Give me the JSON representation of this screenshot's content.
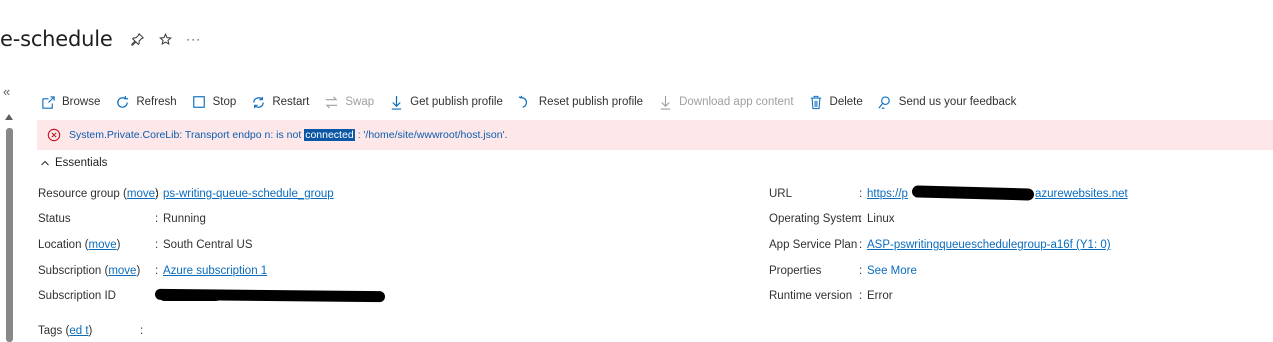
{
  "header": {
    "title": "e-schedule",
    "pin_icon": "pin-icon",
    "star_icon": "star-icon",
    "more_label": "···"
  },
  "sidebar": {
    "collapse_label": "«"
  },
  "toolbar": {
    "items": [
      {
        "label": "Browse",
        "icon": "browse-icon",
        "disabled": false
      },
      {
        "label": "Refresh",
        "icon": "refresh-icon",
        "disabled": false
      },
      {
        "label": "Stop",
        "icon": "stop-icon",
        "disabled": false
      },
      {
        "label": "Restart",
        "icon": "restart-icon",
        "disabled": false
      },
      {
        "label": "Swap",
        "icon": "swap-icon",
        "disabled": true
      },
      {
        "label": "Get publish profile",
        "icon": "download-icon",
        "disabled": false
      },
      {
        "label": "Reset publish profile",
        "icon": "reset-icon",
        "disabled": false
      },
      {
        "label": "Download app content",
        "icon": "download-icon",
        "disabled": true
      },
      {
        "label": "Delete",
        "icon": "trash-icon",
        "disabled": false
      },
      {
        "label": "Send us your feedback",
        "icon": "feedback-icon",
        "disabled": false
      }
    ]
  },
  "error": {
    "icon": "error-circle-icon",
    "text_before": "System.Private.CoreLib: Transport endpo n: is not ",
    "text_highlight": "connected",
    "text_after": " : '/home/site/wwwroot/host.json'."
  },
  "essentials": {
    "label": "Essentials",
    "left": {
      "resource_group": {
        "label": "Resource group (",
        "move": "move",
        "close": ")",
        "value": "ps-writing-queue-schedule_group"
      },
      "status": {
        "label": "Status",
        "value": "Running"
      },
      "location": {
        "label": "Location (",
        "move": "move",
        "close": ")",
        "value": "South Central US"
      },
      "subscription": {
        "label": "Subscription (",
        "move": "move",
        "close": ")",
        "value": "Azure subscription 1"
      },
      "subscription_id": {
        "label": "Subscription ID",
        "value": ""
      },
      "tags": {
        "label": "Tags (",
        "edit": "ed t",
        "close": ")",
        "value": ""
      }
    },
    "right": {
      "url": {
        "label": "URL",
        "value_start": "https://p",
        "value_end": "azurewebsites.net"
      },
      "os": {
        "label": "Operating System",
        "value": "Linux"
      },
      "plan": {
        "label": "App Service Plan",
        "value": "ASP-pswritingqueueschedulegroup-a16f (Y1: 0)"
      },
      "properties": {
        "label": "Properties",
        "value": "See More"
      },
      "runtime": {
        "label": "Runtime version",
        "value": "Error"
      }
    },
    "separator": ":"
  }
}
